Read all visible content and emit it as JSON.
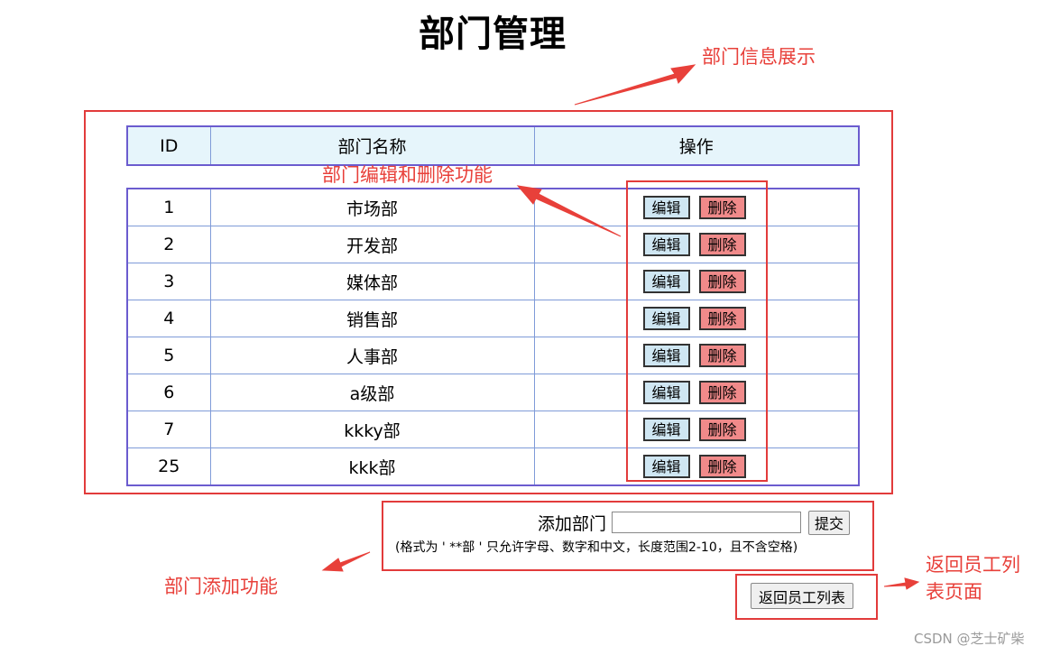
{
  "page": {
    "title": "部门管理"
  },
  "table": {
    "headers": [
      "ID",
      "部门名称",
      "操作"
    ],
    "edit_label": "编辑",
    "delete_label": "删除",
    "rows": [
      {
        "id": "1",
        "name": "市场部"
      },
      {
        "id": "2",
        "name": "开发部"
      },
      {
        "id": "3",
        "name": "媒体部"
      },
      {
        "id": "4",
        "name": "销售部"
      },
      {
        "id": "5",
        "name": "人事部"
      },
      {
        "id": "6",
        "name": "a级部"
      },
      {
        "id": "7",
        "name": "kkky部"
      },
      {
        "id": "25",
        "name": "kkk部"
      }
    ]
  },
  "add_form": {
    "label": "添加部门",
    "input_value": "",
    "submit_label": "提交",
    "hint": "(格式为 ' **部 ' 只允许字母、数字和中文，长度范围2-10，且不含空格)"
  },
  "back_button": {
    "label": "返回员工列表"
  },
  "annotations": {
    "info_display": "部门信息展示",
    "edit_delete": "部门编辑和删除功能",
    "add_feature": "部门添加功能",
    "back_page_line1": "返回员工列",
    "back_page_line2": "表页面"
  },
  "watermark": "CSDN @芝士矿柴",
  "colors": {
    "annotation_red": "#e23b3b",
    "header_bg": "#e6f5fb",
    "edit_bg": "#cfe6f2",
    "delete_bg": "#f08a8a",
    "table_border": "#6b5ccf"
  }
}
